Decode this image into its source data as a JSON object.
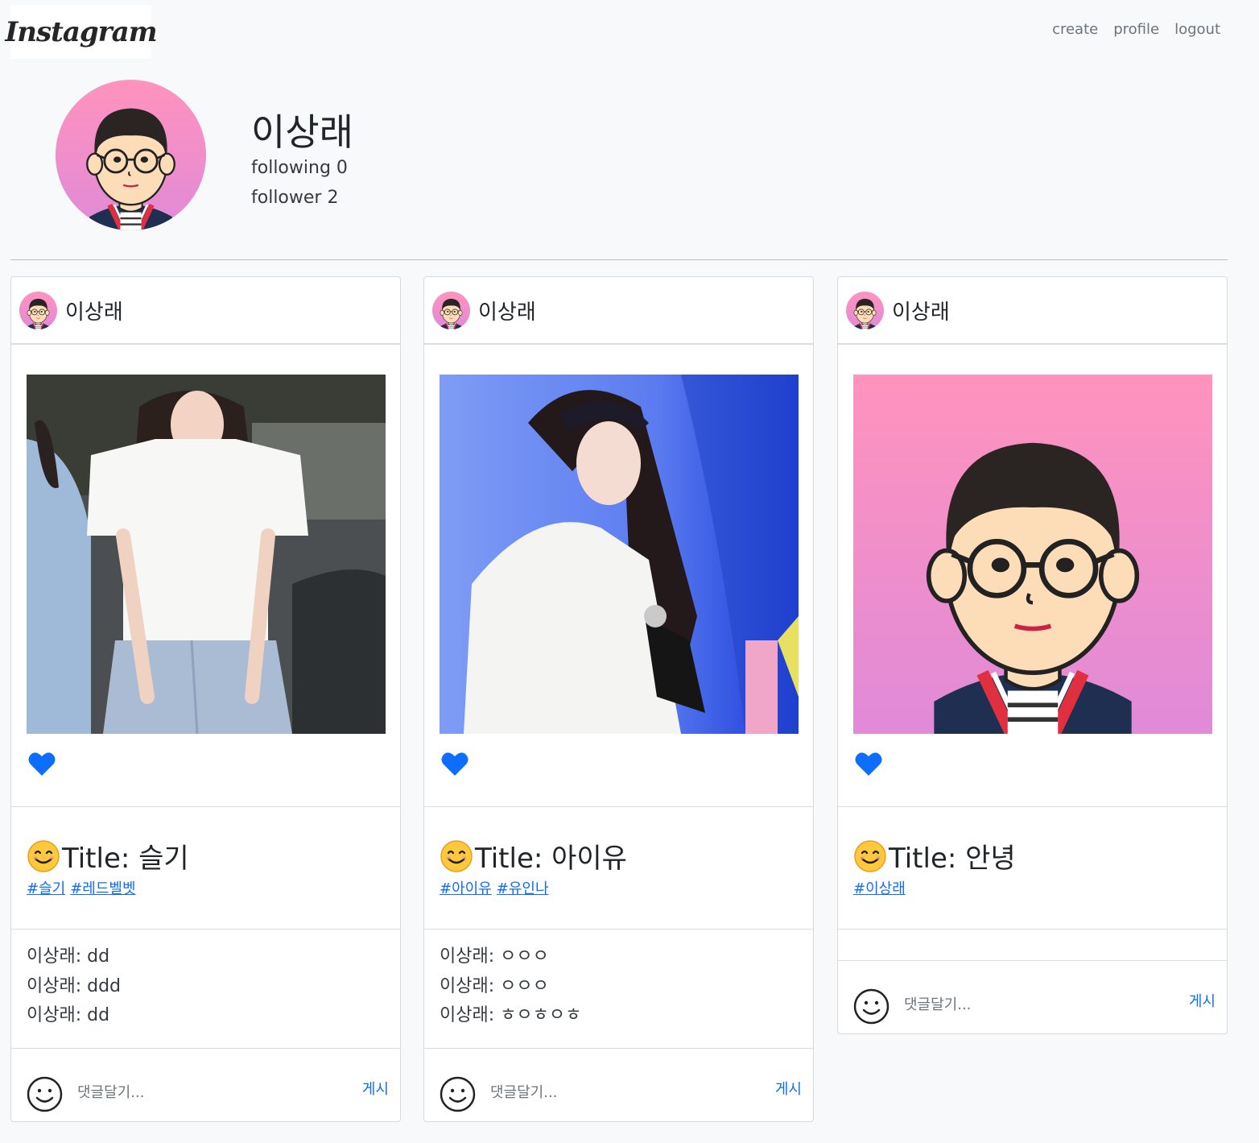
{
  "navbar": {
    "logo_text": "Instagram",
    "links": {
      "create": "create",
      "profile": "profile",
      "logout": "logout"
    }
  },
  "profile": {
    "name": "이상래",
    "following": "following 0",
    "follower": "follower 2"
  },
  "posts": [
    {
      "author": "이상래",
      "image": "photo of a woman in a white t-shirt",
      "title": "Title: 슬기",
      "tags": [
        "#슬기",
        "#레드벨벳"
      ],
      "comments": [
        "이상래: dd",
        "이상래: ddd",
        "이상래: dd"
      ],
      "comment_placeholder": "댓글달기...",
      "post_button": "게시"
    },
    {
      "author": "이상래",
      "image": "photo of a woman in a white blouse on blue background",
      "title": "Title: 아이유",
      "tags": [
        "#아이유",
        "#유인나"
      ],
      "comments": [
        "이상래: ㅇㅇㅇ",
        "이상래: ㅇㅇㅇ",
        "이상래: ㅎㅇㅎㅇㅎ"
      ],
      "comment_placeholder": "댓글달기...",
      "post_button": "게시"
    },
    {
      "author": "이상래",
      "image": "cartoon avatar of a man with glasses",
      "title": "Title: 안녕",
      "tags": [
        "#이상래"
      ],
      "comments": [],
      "comment_placeholder": "댓글달기...",
      "post_button": "게시"
    }
  ],
  "colors": {
    "accent": "#0d6efd",
    "background": "#f8f9fa",
    "avatar_gradient_top": "#ff93bd",
    "avatar_gradient_bottom": "#e48fd8"
  }
}
